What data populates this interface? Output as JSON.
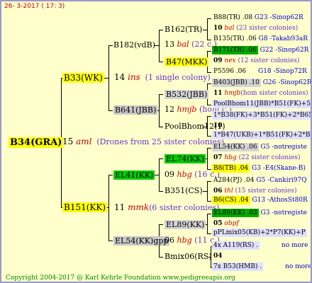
{
  "date": "26- 3-2017 ( 17: 3)",
  "copyright": "Copyright 2004-2017 @ Karl Kehrle Foundation   www.pedigreeapis.org",
  "root": {
    "id": "B34(GRA)",
    "year": "15",
    "breeder": "aml",
    "note": "(Drones from 25 sister colonies)"
  },
  "gen1": {
    "sire": {
      "id": "B33(WK)",
      "year": "14",
      "breeder": "ins",
      "note": "(1 single colony)"
    },
    "dam": {
      "id": "B151(KK)",
      "year": "11",
      "breeder": "mmk",
      "note": "(6 sister colonies)"
    }
  },
  "gen2": {
    "a": {
      "id": "B182(vdB)"
    },
    "b": {
      "id": "B641(JBB)",
      "year": "12",
      "breeder": "hmjb",
      "note": "(hom c.)"
    },
    "c": {
      "id": "EL41(KK)",
      "year": "09",
      "breeder": "hbg",
      "note": "(16 c.)"
    },
    "d": {
      "id": "EL54(KK)gpp",
      "year": "06",
      "breeder": "hbg",
      "note": "(11 c.)"
    }
  },
  "gen2_extra": {
    "a_year": "13",
    "a_breeder": "bal",
    "a_note": "(22 c.)"
  },
  "gen3": [
    {
      "id": "B162(TR)"
    },
    {
      "id": "B47(MKK)"
    },
    {
      "id": "B532(JBB)"
    },
    {
      "id": "PoolBhom12(1)"
    },
    {
      "id": "EL74(KK)"
    },
    {
      "id": "B351(CS)"
    },
    {
      "id": "EL89(KK)"
    },
    {
      "id": "Bmix06(RS)"
    }
  ],
  "gen4": [
    {
      "id": "B88(TR) .08",
      "right": "G23 -Sinop62R"
    },
    {
      "line": "10",
      "breeder": "bal",
      "note": "(23 sister colonies)"
    },
    {
      "id": "B135(TR) .06",
      "right": "G8 -Takab93aR"
    },
    {
      "id": "B171(TR) .06",
      "right": "G22 -Sinop62R"
    },
    {
      "line": "09",
      "breeder": "nex",
      "note": "(12 sister colonies)"
    },
    {
      "id": "P5596 .06",
      "right": "G18 -Sinop72R"
    },
    {
      "id": "B403(JBB) .10",
      "right": "G26 -Sinop62R"
    },
    {
      "line": "11",
      "breeder": "hmjb",
      "note": "(hom sister colonies)"
    },
    {
      "id": "PoolBhom11(JBB)*B51(FK)+5"
    },
    {
      "id": "1*B38(FK)+3*B51(FK)+2*B65(FK)"
    },
    {
      "line": "10"
    },
    {
      "id": "1*B47(UKB)+1*B51(FK)+2*B65(FK)"
    },
    {
      "id": "EL54(KK) .06",
      "right": "G5 -notregiste"
    },
    {
      "line": "07",
      "breeder": "hbg",
      "note": "(22 sister colonies)"
    },
    {
      "id": "B8(TB) .04",
      "right": "G3 -E4(Skane-B)"
    },
    {
      "id": "A284(PJ) .04",
      "right": "G5 -Cankiri97Q"
    },
    {
      "line": "06",
      "breeder": "thl",
      "note": "(15 sister colonies)"
    },
    {
      "id": "B6(CS) .04",
      "right": "G13 -AthosSt80R"
    },
    {
      "id": "EL89(KK) .03",
      "right": "G3 -notregiste"
    },
    {
      "line": "05",
      "breeder": "obpf"
    },
    {
      "id": "pPLmix05(KB)+2*P7(KK)+P"
    },
    {
      "id": "4x A119(RS) .",
      "right": "no more"
    },
    {
      "line": "04"
    },
    {
      "id": "7x B53(HMB) .",
      "right": "no more"
    }
  ]
}
